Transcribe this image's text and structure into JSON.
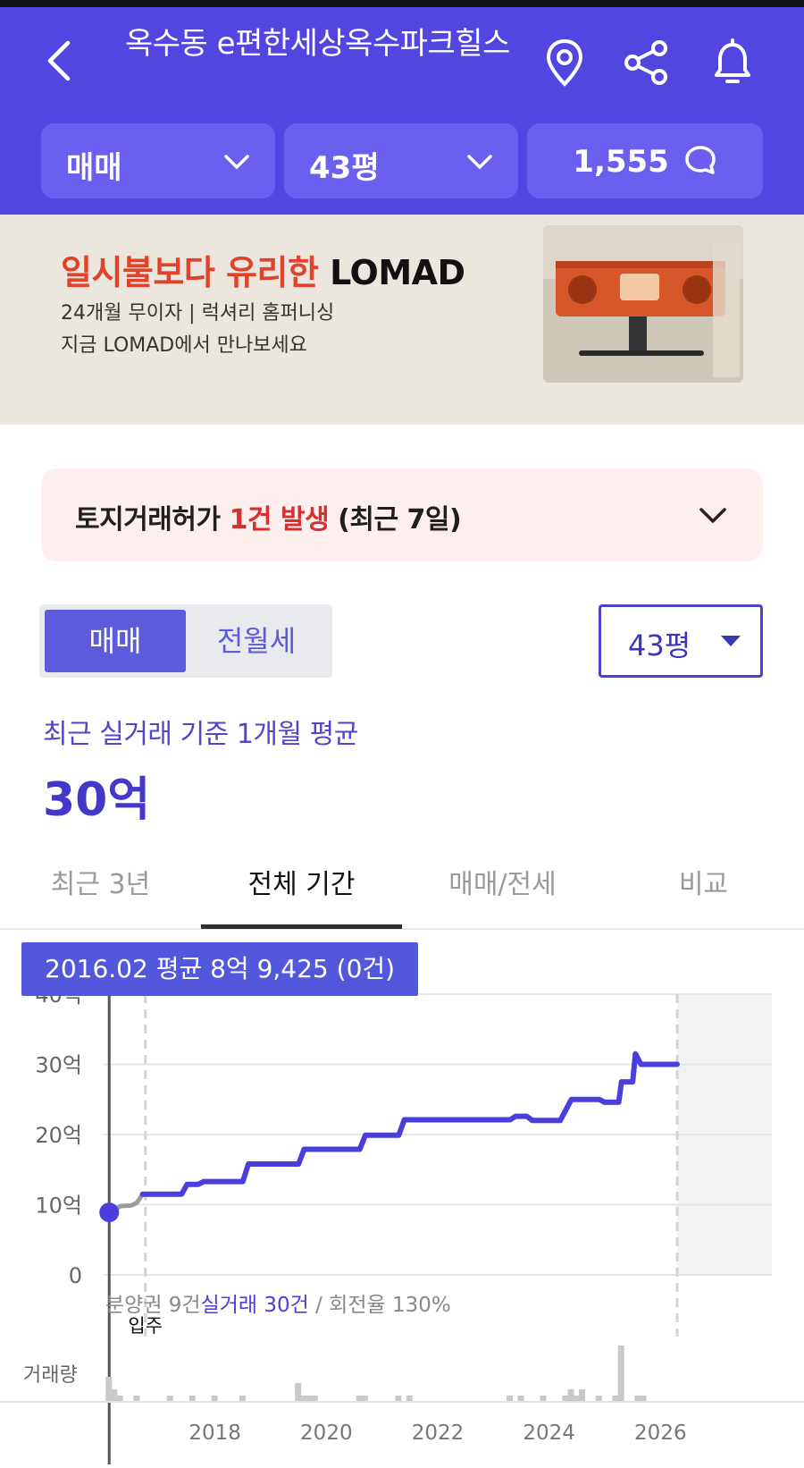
{
  "header": {
    "title": "옥수동 e편한세상옥수파크힐스",
    "icons": [
      "back-icon",
      "location-pin-icon",
      "share-icon",
      "bell-icon"
    ],
    "filters": {
      "deal_type": "매매",
      "size": "43평",
      "comments": "1,555"
    }
  },
  "banner": {
    "headline_accent": "일시불보다 유리한",
    "headline_brand": "LOMAD",
    "line1": "24개월 무이자 | 럭셔리 홈퍼니싱",
    "line2": "지금 LOMAD에서 만나보세요"
  },
  "notice": {
    "prefix": "토지거래허가",
    "highlight": "1건 발생",
    "suffix": "(최근 7일)"
  },
  "segment": {
    "active": "매매",
    "inactive": "전월세"
  },
  "size_select": "43평",
  "average": {
    "label": "최근 실거래 기준 1개월 평균",
    "value": "30억"
  },
  "tabs": [
    "최근 3년",
    "전체 기간",
    "매매/전세",
    "비교"
  ],
  "active_tab": 1,
  "colors": {
    "primary": "#5246e1",
    "line": "#4a3fdc",
    "accent_red": "#d3302f"
  },
  "chart_data": {
    "type": "line",
    "tooltip": "2016.02 평균 8억 9,425 (0건)",
    "y_ticks": [
      "40억",
      "30억",
      "20억",
      "10억",
      "0"
    ],
    "ylim": [
      0,
      40
    ],
    "x_ticks": [
      "2018",
      "2020",
      "2022",
      "2024",
      "2026"
    ],
    "xlim": [
      2016.0,
      2028.0
    ],
    "stats": {
      "presale": "분양권 9건",
      "trades": "실거래 30건",
      "turnover": "/ 회전율 130%"
    },
    "move_in_label": "입주",
    "move_in_x": 2016.75,
    "future_start_x": 2026.3,
    "volume_label": "거래량",
    "series": [
      {
        "name": "분양권",
        "points": [
          [
            2016.1,
            8.9
          ],
          [
            2016.2,
            9.3
          ],
          [
            2016.3,
            9.8
          ],
          [
            2016.5,
            9.9
          ],
          [
            2016.6,
            10.3
          ],
          [
            2016.7,
            11.5
          ]
        ]
      },
      {
        "name": "실거래",
        "points": [
          [
            2016.7,
            11.5
          ],
          [
            2017.4,
            11.5
          ],
          [
            2017.5,
            12.9
          ],
          [
            2017.7,
            12.9
          ],
          [
            2017.8,
            13.3
          ],
          [
            2018.5,
            13.3
          ],
          [
            2018.6,
            15.8
          ],
          [
            2019.5,
            15.8
          ],
          [
            2019.6,
            17.9
          ],
          [
            2020.6,
            17.9
          ],
          [
            2020.7,
            19.9
          ],
          [
            2021.3,
            19.9
          ],
          [
            2021.4,
            22.1
          ],
          [
            2023.3,
            22.1
          ],
          [
            2023.4,
            22.6
          ],
          [
            2023.6,
            22.6
          ],
          [
            2023.7,
            22.0
          ],
          [
            2024.2,
            22.0
          ],
          [
            2024.4,
            25.0
          ],
          [
            2024.9,
            25.0
          ],
          [
            2025.0,
            24.6
          ],
          [
            2025.25,
            24.6
          ],
          [
            2025.3,
            27.5
          ],
          [
            2025.5,
            27.5
          ],
          [
            2025.55,
            31.5
          ],
          [
            2025.65,
            30.0
          ],
          [
            2026.3,
            30.0
          ]
        ]
      }
    ],
    "volume": [
      [
        2016.1,
        4
      ],
      [
        2016.2,
        2
      ],
      [
        2016.3,
        1
      ],
      [
        2016.6,
        1
      ],
      [
        2017.2,
        1
      ],
      [
        2017.6,
        1
      ],
      [
        2018.0,
        1
      ],
      [
        2018.5,
        1
      ],
      [
        2019.5,
        3
      ],
      [
        2019.6,
        1
      ],
      [
        2019.7,
        1
      ],
      [
        2019.8,
        1
      ],
      [
        2020.6,
        1
      ],
      [
        2020.7,
        1
      ],
      [
        2021.3,
        1
      ],
      [
        2021.5,
        1
      ],
      [
        2023.3,
        1
      ],
      [
        2023.5,
        1
      ],
      [
        2023.9,
        1
      ],
      [
        2024.3,
        1
      ],
      [
        2024.4,
        2
      ],
      [
        2024.5,
        1
      ],
      [
        2024.6,
        2
      ],
      [
        2024.9,
        1
      ],
      [
        2025.2,
        1
      ],
      [
        2025.3,
        9
      ],
      [
        2025.6,
        1
      ],
      [
        2025.7,
        1
      ]
    ]
  }
}
